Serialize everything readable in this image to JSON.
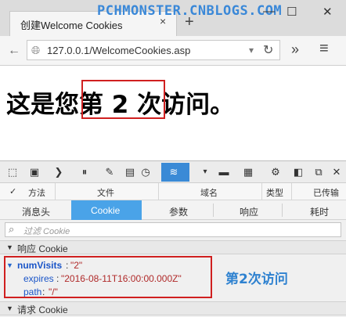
{
  "watermark": "PCHMONSTER.CNBLOGS.COM",
  "tab": {
    "title": "创建Welcome Cookies",
    "close_glyph": "×",
    "new_tab_glyph": "+"
  },
  "window": {
    "minimize": "—",
    "maximize": "☐",
    "close": "✕"
  },
  "nav": {
    "back": "←",
    "forward": "→",
    "url": "127.0.0.1/WelcomeCookies.asp",
    "dropdown": "▾",
    "refresh": "↻",
    "more": "»",
    "menu": "≡"
  },
  "page": {
    "heading": "这是您第 2 次访问。"
  },
  "devtools": {
    "toolbar_icons": [
      "cursor-icon",
      "box-icon",
      "console-icon",
      "debugger-icon",
      "edit-icon",
      "file-icon",
      "performance-icon",
      "network-icon",
      "dropdown-icon",
      "screen-icon",
      "storage-icon",
      "settings-icon",
      "dock-icon",
      "popout-icon",
      "close-icon"
    ],
    "columns": [
      "✓",
      "方法",
      "文件",
      "域名",
      "类型",
      "已传输"
    ],
    "subtabs": [
      "消息头",
      "Cookie",
      "参数",
      "响应",
      "耗时"
    ],
    "active_subtab": "Cookie",
    "filter_placeholder": "过滤 Cookie",
    "response_section": "响应 Cookie",
    "request_section": "请求 Cookie",
    "cookie": {
      "name": "numVisits",
      "value": "\"2\"",
      "expires_key": "expires",
      "expires_value": "\"2016-08-11T16:00:00.000Z\"",
      "path_key": "path",
      "path_value": "\"/\""
    },
    "note": "第2次访问"
  },
  "colors": {
    "accent": "#3a8ad6",
    "highlight": "#d02020",
    "note": "#2f82d0"
  }
}
